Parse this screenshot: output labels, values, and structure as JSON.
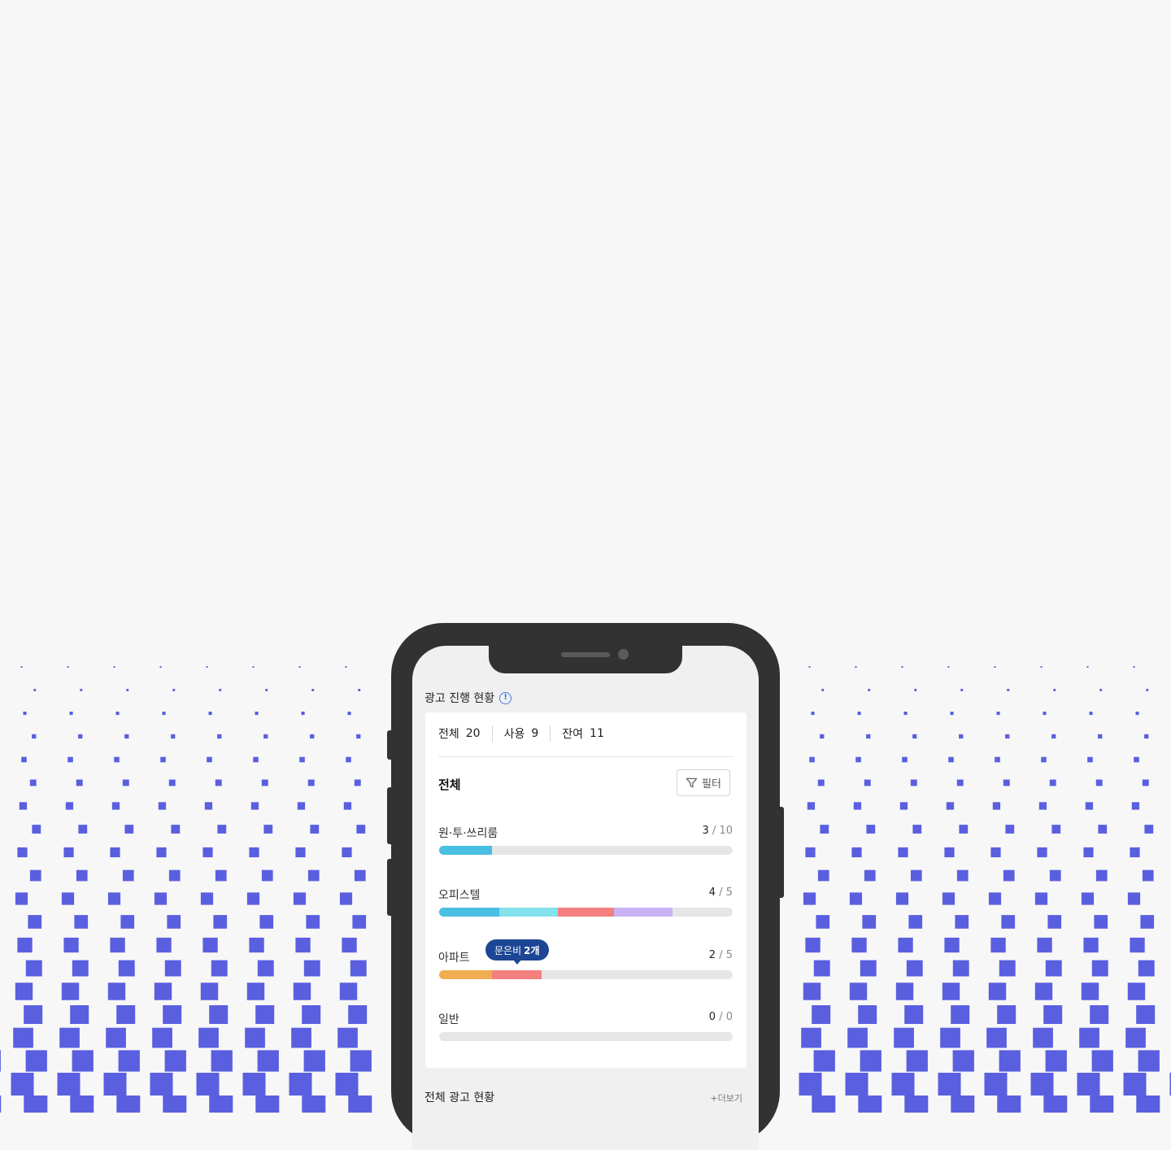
{
  "colors": {
    "accent": "#5a5fe0",
    "background": "#f7f7f7",
    "phone_frame": "#323232",
    "tooltip": "#1c4694",
    "info": "#3f7be0"
  },
  "status": {
    "title": "광고 진행 현황",
    "info_icon": "info-icon",
    "summary": {
      "total_label": "전체",
      "total_value": "20",
      "used_label": "사용",
      "used_value": "9",
      "remain_label": "잔여",
      "remain_value": "11"
    },
    "group_title": "전체",
    "filter_label": "필터",
    "filter_icon": "funnel-icon",
    "rows": [
      {
        "label": "원·투·쓰리룸",
        "used": "3",
        "total": "10",
        "segments": [
          {
            "value": 0.18,
            "color": "#48bfe3"
          }
        ]
      },
      {
        "label": "오피스텔",
        "used": "4",
        "total": "5",
        "segments": [
          {
            "value": 0.205,
            "color": "#48bfe3"
          },
          {
            "value": 0.2,
            "color": "#83e2ec"
          },
          {
            "value": 0.19,
            "color": "#f47f7f"
          },
          {
            "value": 0.2,
            "color": "#c9b3f5"
          }
        ]
      },
      {
        "label": "아파트",
        "used": "2",
        "total": "5",
        "tooltip_prefix": "문은비",
        "tooltip_value": "2개",
        "segments": [
          {
            "value": 0.18,
            "color": "#f0ae50"
          },
          {
            "value": 0.17,
            "color": "#f47f7f"
          }
        ]
      },
      {
        "label": "일반",
        "used": "0",
        "total": "0",
        "segments": []
      }
    ]
  },
  "overview": {
    "title": "전체 광고 현황",
    "more_label": "+더보기"
  }
}
